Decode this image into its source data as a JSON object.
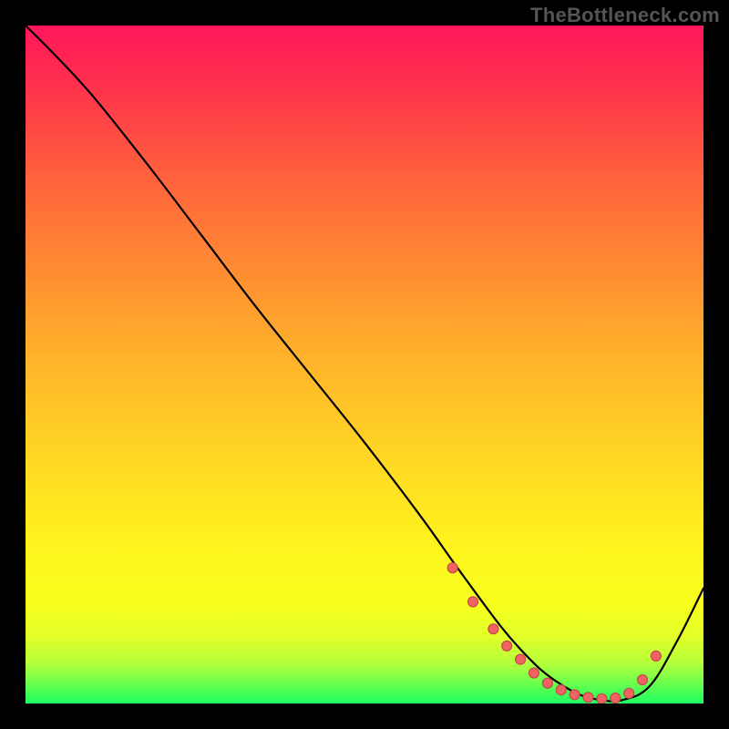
{
  "watermark": "TheBottleneck.com",
  "chart_data": {
    "type": "line",
    "title": "",
    "xlabel": "",
    "ylabel": "",
    "xlim": [
      0,
      100
    ],
    "ylim": [
      0,
      100
    ],
    "series": [
      {
        "name": "curve",
        "x": [
          0,
          4,
          10,
          18,
          26,
          34,
          42,
          50,
          58,
          63,
          67,
          70,
          73,
          76,
          79,
          82,
          85,
          88,
          92,
          96,
          100
        ],
        "y": [
          100,
          96,
          89.5,
          79.5,
          69,
          58.5,
          48.5,
          38.5,
          28,
          21,
          15.5,
          11.5,
          8,
          5,
          2.8,
          1.2,
          0.5,
          0.5,
          2.5,
          9,
          17
        ]
      }
    ],
    "markers": {
      "comment": "salmon dots hugging the valley of the curve",
      "x": [
        63,
        66,
        69,
        71,
        73,
        75,
        77,
        79,
        81,
        83,
        85,
        87,
        89,
        91,
        93
      ],
      "y": [
        20,
        15,
        11,
        8.5,
        6.5,
        4.5,
        3,
        2,
        1.3,
        0.9,
        0.7,
        0.8,
        1.5,
        3.5,
        7
      ]
    },
    "gradient_stops": [
      {
        "pos": 0,
        "color": "#ff165b"
      },
      {
        "pos": 8,
        "color": "#ff2f4e"
      },
      {
        "pos": 20,
        "color": "#ff5a3f"
      },
      {
        "pos": 33,
        "color": "#ff8334"
      },
      {
        "pos": 48,
        "color": "#ffb02b"
      },
      {
        "pos": 62,
        "color": "#ffd324"
      },
      {
        "pos": 76,
        "color": "#fff21e"
      },
      {
        "pos": 85,
        "color": "#f8ff1c"
      },
      {
        "pos": 90,
        "color": "#e3ff28"
      },
      {
        "pos": 94,
        "color": "#b6ff3a"
      },
      {
        "pos": 97,
        "color": "#6bff4d"
      },
      {
        "pos": 100,
        "color": "#1dff61"
      }
    ]
  }
}
